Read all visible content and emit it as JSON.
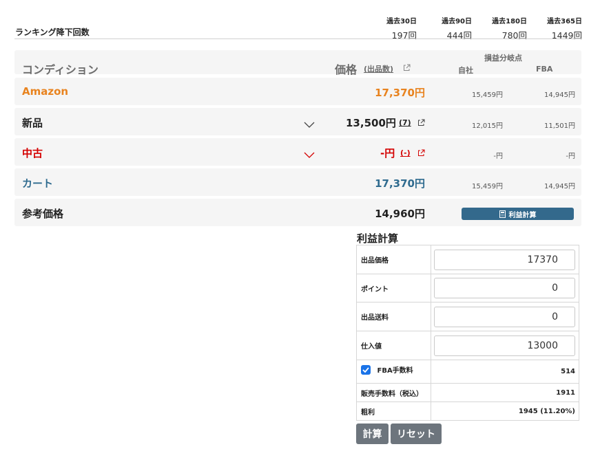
{
  "ranking": {
    "title": "ランキング降下回数",
    "periods": [
      {
        "label": "過去30日",
        "value": "197回"
      },
      {
        "label": "過去90日",
        "value": "444回"
      },
      {
        "label": "過去180日",
        "value": "780回"
      },
      {
        "label": "過去365日",
        "value": "1449回"
      }
    ]
  },
  "table_header": {
    "condition": "コンディション",
    "price": "価格",
    "count": "(出品数)",
    "breakeven": "損益分岐点",
    "self": "自社",
    "fba": "FBA"
  },
  "rows": [
    {
      "label": "Amazon",
      "price": "17,370円",
      "count": "",
      "self": "15,459円",
      "fba": "14,945円"
    },
    {
      "label": "新品",
      "price": "13,500円",
      "count": "(7)",
      "self": "12,015円",
      "fba": "11,501円"
    },
    {
      "label": "中古",
      "price": "-円",
      "count": "(-)",
      "self": "-円",
      "fba": "-円"
    },
    {
      "label": "カート",
      "price": "17,370円",
      "count": "",
      "self": "15,459円",
      "fba": "14,945円"
    },
    {
      "label": "参考価格",
      "price": "14,960円",
      "count": "",
      "self": "",
      "fba": ""
    }
  ],
  "calc_button_label": "利益計算",
  "profit_calc": {
    "title": "利益計算",
    "fields": [
      {
        "label": "出品価格",
        "value": "17370"
      },
      {
        "label": "ポイント",
        "value": "0"
      },
      {
        "label": "出品送料",
        "value": "0"
      },
      {
        "label": "仕入値",
        "value": "13000"
      }
    ],
    "fba_fee_label": "FBA手数料",
    "fba_fee_value": "514",
    "fba_checked": true,
    "sales_fee_label": "販売手数料（税込）",
    "sales_fee_value": "1911",
    "gross_profit_label": "粗利",
    "gross_profit_value": "1945 (11.20%)"
  },
  "buttons": {
    "calculate": "計算",
    "reset": "リセット"
  },
  "colors": {
    "amazon": "#e8831f",
    "used": "#d40000",
    "cart": "#2f6b8f",
    "button_blue": "#33698c",
    "button_gray": "#6d757d"
  }
}
